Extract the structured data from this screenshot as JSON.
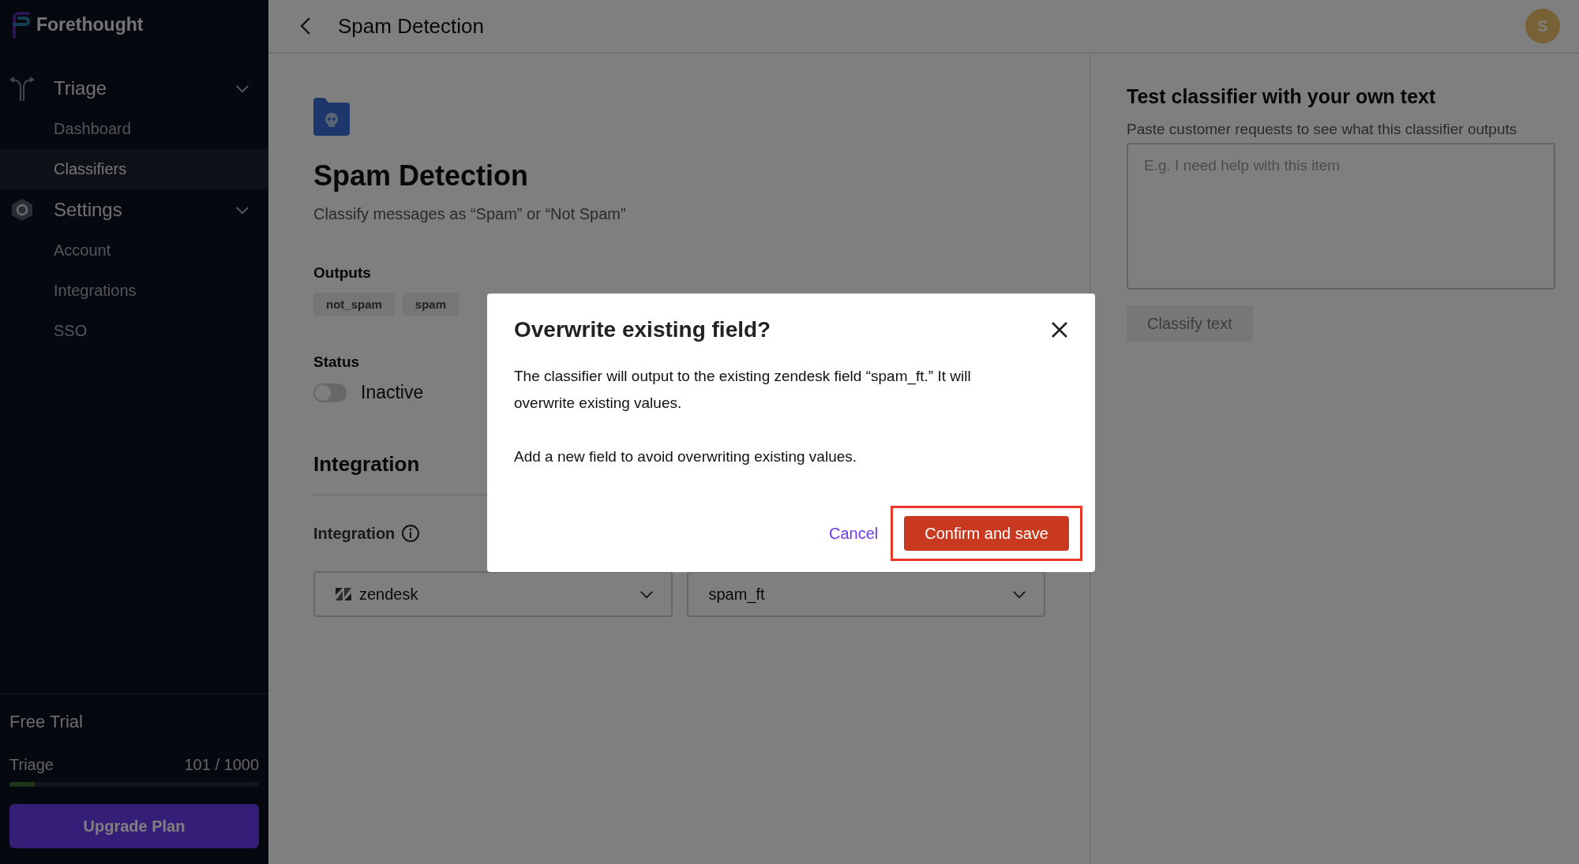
{
  "sidebar": {
    "brand": "Forethought",
    "sections": [
      {
        "kind": "triage",
        "label": "Triage",
        "expanded": true,
        "children": [
          {
            "label": "Dashboard",
            "selected": false
          },
          {
            "label": "Classifiers",
            "selected": true
          }
        ]
      },
      {
        "kind": "settings",
        "label": "Settings",
        "expanded": true,
        "children": [
          {
            "label": "Account",
            "selected": false
          },
          {
            "label": "Integrations",
            "selected": false
          },
          {
            "label": "SSO",
            "selected": false
          }
        ]
      }
    ],
    "plan": {
      "title": "Free Trial",
      "usage_label": "Triage",
      "usage_value": "101 / 1000",
      "level": 0.1,
      "button": "Upgrade Plan"
    }
  },
  "header": {
    "title": "Spam Detection",
    "avatar": "S"
  },
  "classifier": {
    "title": "Spam Detection",
    "description": "Classify messages as “Spam” or “Not Spam”",
    "outputs_label": "Outputs",
    "outputs": [
      "not_spam",
      "spam"
    ],
    "status_label": "Status",
    "status": {
      "on": false,
      "label": "Inactive"
    },
    "integration_heading": "Integration",
    "integration_label": "Integration",
    "integration_select": "zendesk",
    "field_select": "spam_ft"
  },
  "test_panel": {
    "title": "Test classifier with your own text",
    "hint": "Paste customer requests to see what this classifier outputs",
    "placeholder": "E.g. I need help with this item",
    "button": {
      "label": "Classify text",
      "disabled": true
    }
  },
  "modal": {
    "title": "Overwrite existing field?",
    "paragraphs": [
      "The classifier will output to the existing zendesk field “spam_ft.” It will overwrite existing values.",
      "Add a new field to avoid overwriting existing values."
    ],
    "cancel": "Cancel",
    "confirm": {
      "label": "Confirm and save",
      "highlighted": true
    }
  }
}
